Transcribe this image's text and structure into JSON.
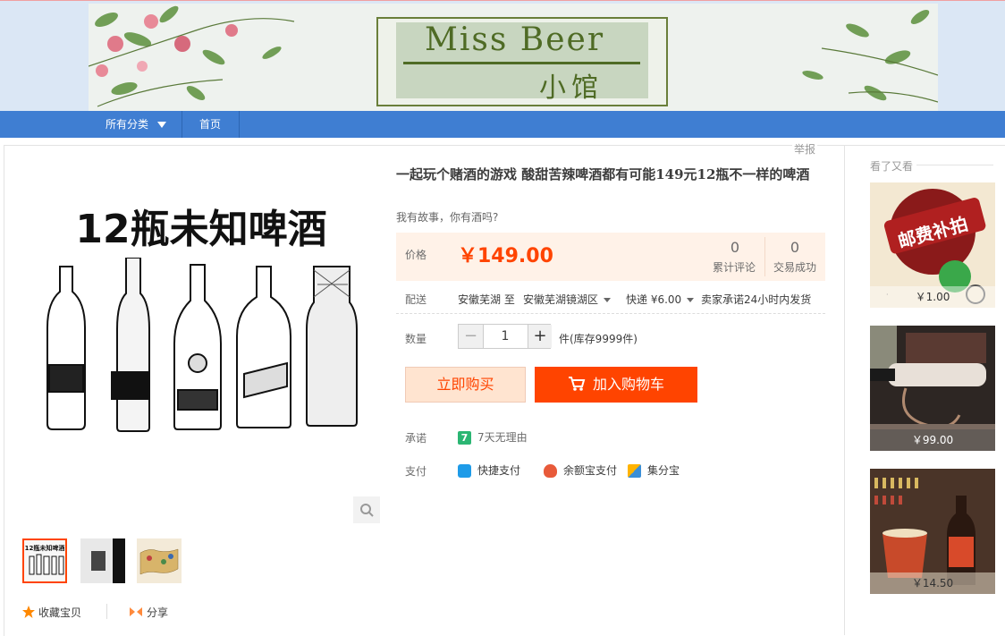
{
  "header": {
    "logo_title": "Miss Beer",
    "logo_subtitle": "小馆"
  },
  "nav": {
    "categories_label": "所有分类",
    "home_label": "首页"
  },
  "report_label": "举报",
  "gallery": {
    "main_image_heading": "12瓶未知啤酒",
    "thumbnails": [
      {
        "label": "12瓶未知啤酒"
      },
      {
        "label": ""
      },
      {
        "label": ""
      }
    ]
  },
  "actions": {
    "favorite_label": "收藏宝贝",
    "share_label": "分享"
  },
  "product": {
    "title": "一起玩个赌酒的游戏 酸甜苦辣啤酒都有可能149元12瓶不一样的啤酒",
    "subtitle": "我有故事，你有酒吗?",
    "price_label": "价格",
    "price": "￥149.00",
    "reviews_count": "0",
    "reviews_label": "累计评论",
    "sales_count": "0",
    "sales_label": "交易成功",
    "shipping_label": "配送",
    "ship_from": "安徽芜湖 至",
    "ship_to": "安徽芜湖镜湖区",
    "ship_fee": "快递 ¥6.00",
    "ship_promise": "卖家承诺24小时内发货",
    "quantity_label": "数量",
    "quantity_value": "1",
    "stock_text": "件(库存9999件)",
    "buy_now_label": "立即购买",
    "add_to_cart_label": "加入购物车",
    "promise_label": "承诺",
    "promise_text": "7天无理由",
    "promise_badge": "7",
    "payment_label": "支付",
    "payment_methods": [
      "快捷支付",
      "余额宝支付",
      "集分宝"
    ]
  },
  "sidebar": {
    "title": "看了又看",
    "items": [
      {
        "price": "￥1.00",
        "image_text": "邮费补拍"
      },
      {
        "price": "￥99.00"
      },
      {
        "price": "￥14.50"
      }
    ]
  },
  "colors": {
    "accent": "#ff4400",
    "nav_blue": "#3f7ed2",
    "price_bg": "#fff2e8",
    "logo_green": "#4f6b25"
  }
}
